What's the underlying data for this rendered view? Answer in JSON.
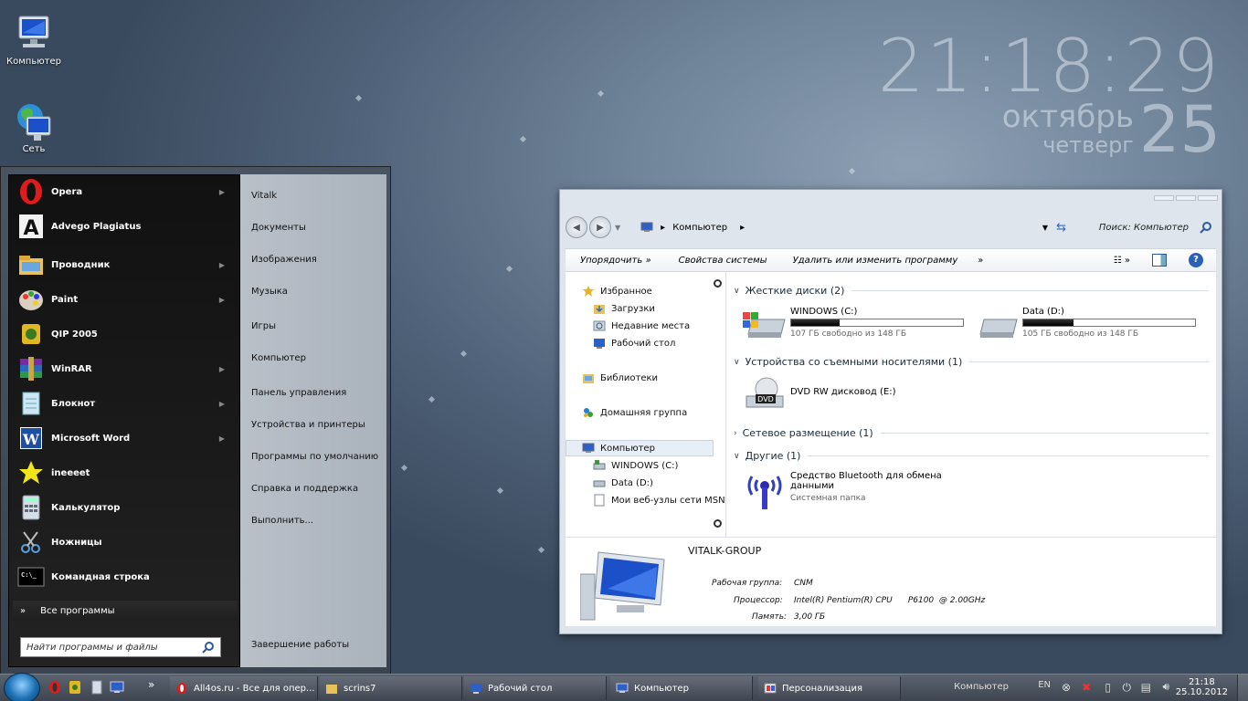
{
  "desktop": {
    "icons": [
      {
        "label": "Компьютер"
      },
      {
        "label": "Сеть"
      }
    ],
    "clock": {
      "time": "21:18:29",
      "month": "октябрь",
      "weekday": "четверг",
      "day": "25"
    }
  },
  "start_menu": {
    "programs": [
      {
        "label": "Opera",
        "icon": "opera-icon",
        "arrow": true
      },
      {
        "label": "Advego Plagiatus",
        "icon": "advego-icon",
        "arrow": false
      },
      {
        "label": "Проводник",
        "icon": "explorer-folder-icon",
        "arrow": true
      },
      {
        "label": "Paint",
        "icon": "paint-icon",
        "arrow": true
      },
      {
        "label": "QIP 2005",
        "icon": "qip-icon",
        "arrow": false
      },
      {
        "label": "WinRAR",
        "icon": "winrar-icon",
        "arrow": true
      },
      {
        "label": "Блокнот",
        "icon": "notepad-icon",
        "arrow": true
      },
      {
        "label": "Microsoft Word",
        "icon": "word-icon",
        "arrow": true
      },
      {
        "label": "ineeeet",
        "icon": "star-icon",
        "arrow": false
      },
      {
        "label": "Калькулятор",
        "icon": "calculator-icon",
        "arrow": false
      },
      {
        "label": "Ножницы",
        "icon": "scissors-icon",
        "arrow": false
      },
      {
        "label": "Командная строка",
        "icon": "cmd-icon",
        "arrow": false
      }
    ],
    "all_programs": "Все программы",
    "search_placeholder": "Найти программы и файлы",
    "right_items": [
      "Vitalk",
      "Документы",
      "Изображения",
      "Музыка",
      "Игры",
      "Компьютер",
      "Панель управления",
      "Устройства и принтеры",
      "Программы по умолчанию",
      "Справка и поддержка",
      "Выполнить..."
    ],
    "shutdown": "Завершение работы"
  },
  "explorer": {
    "address": "Компьютер",
    "search": "Поиск: Компьютер",
    "toolbar": [
      "Упорядочить »",
      "Свойства системы",
      "Удалить или изменить программу",
      "»"
    ],
    "nav": [
      {
        "label": "Избранное",
        "level": 0
      },
      {
        "label": "Загрузки",
        "level": 1
      },
      {
        "label": "Недавние места",
        "level": 1
      },
      {
        "label": "Рабочий стол",
        "level": 1
      },
      {
        "label": "Библиотеки",
        "level": 0
      },
      {
        "label": "Домашняя группа",
        "level": 0
      },
      {
        "label": "Компьютер",
        "level": 0
      },
      {
        "label": "WINDOWS (C:)",
        "level": 1
      },
      {
        "label": "Data (D:)",
        "level": 1
      },
      {
        "label": "Мои веб-узлы сети MSN",
        "level": 1
      }
    ],
    "groups": {
      "hdd": "Жесткие диски (2)",
      "removable": "Устройства со съемными носителями (1)",
      "network": "Сетевое размещение (1)",
      "other": "Другие (1)"
    },
    "drives": [
      {
        "name": "WINDOWS (C:)",
        "free": "107 ГБ свободно из 148 ГБ",
        "used_fraction": 0.28
      },
      {
        "name": "Data (D:)",
        "free": "105 ГБ свободно из 148 ГБ",
        "used_fraction": 0.29
      }
    ],
    "dvd": "DVD RW дисковод (E:)",
    "dvd_badge": "DVD",
    "bluetooth": {
      "name1": "Средство Bluetooth для обмена",
      "name2": "данными",
      "sub": "Системная папка"
    },
    "details": {
      "name": "VITALK-GROUP",
      "workgroup_label": "Рабочая группа:",
      "workgroup": "CNM",
      "cpu_label": "Процессор:",
      "cpu": "Intel(R) Pentium(R) CPU      P6100  @ 2.00GHz",
      "mem_label": "Память:",
      "mem": "3,00 ГБ"
    }
  },
  "taskbar": {
    "buttons": [
      {
        "label": "All4os.ru - Все для опер...",
        "icon": "opera-icon"
      },
      {
        "label": "scrins7",
        "icon": "folder-icon"
      },
      {
        "label": "Рабочий стол",
        "icon": "desktop-icon"
      },
      {
        "label": "Компьютер",
        "icon": "computer-icon"
      },
      {
        "label": "Персонализация",
        "icon": "personalization-icon"
      }
    ],
    "tray_label": "Компьютер",
    "lang": "EN",
    "time": "21:18",
    "date": "25.10.2012"
  }
}
